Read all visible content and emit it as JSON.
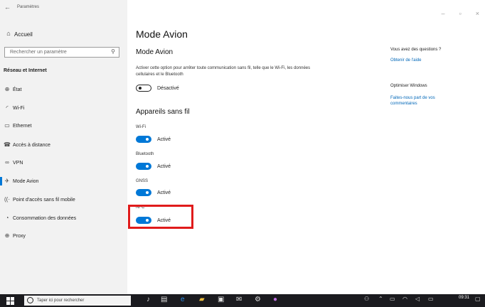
{
  "window": {
    "title": "Paramètres",
    "controls": [
      "–",
      "▫",
      "×"
    ]
  },
  "sidebar": {
    "home_label": "Accueil",
    "search_placeholder": "Rechercher un paramètre",
    "section_title": "Réseau et Internet",
    "items": [
      {
        "label": "État",
        "icon": "globe-icon",
        "glyph": "⊕"
      },
      {
        "label": "Wi-Fi",
        "icon": "wifi-icon",
        "glyph": "◜"
      },
      {
        "label": "Ethernet",
        "icon": "ethernet-icon",
        "glyph": "▭"
      },
      {
        "label": "Accès à distance",
        "icon": "dialup-icon",
        "glyph": "☎"
      },
      {
        "label": "VPN",
        "icon": "vpn-icon",
        "glyph": "∞"
      },
      {
        "label": "Mode Avion",
        "icon": "airplane-icon",
        "glyph": "✈"
      },
      {
        "label": "Point d'accès sans fil mobile",
        "icon": "hotspot-icon",
        "glyph": "((·"
      },
      {
        "label": "Consommation des données",
        "icon": "data-usage-icon",
        "glyph": "◔"
      },
      {
        "label": "Proxy",
        "icon": "proxy-icon",
        "glyph": "⊕"
      }
    ],
    "active_item": "Mode Avion"
  },
  "main": {
    "title": "Mode Avion",
    "subtitle": "Mode Avion",
    "description": "Activer cette option pour arrêter toute communication sans fil, telle que le Wi-Fi, les données cellulaires et le Bluetooth",
    "airplane_toggle_state": "Désactivé",
    "devices_title": "Appareils sans fil",
    "devices": [
      {
        "label": "Wi-Fi",
        "state": "Activé",
        "on": true
      },
      {
        "label": "Bluetooth",
        "state": "Activé",
        "on": true
      },
      {
        "label": "GNSS",
        "state": "Activé",
        "on": true
      },
      {
        "label": "NFC",
        "state": "Activé",
        "on": true
      }
    ],
    "highlight_color": "#e01b1b"
  },
  "aside": {
    "questions": "Vous avez des questions ?",
    "help_link": "Obtenir de l'aide",
    "improve": "Optimiser Windows",
    "feedback_link": "Faites-nous part de vos commentaires"
  },
  "taskbar": {
    "search_placeholder": "Taper ici pour rechercher",
    "clock": "09:31"
  },
  "colors": {
    "accent": "#0078d7",
    "link": "#0067b8",
    "sidebar_bg": "#f2f2f2",
    "taskbar_bg": "#1b1b1f"
  }
}
